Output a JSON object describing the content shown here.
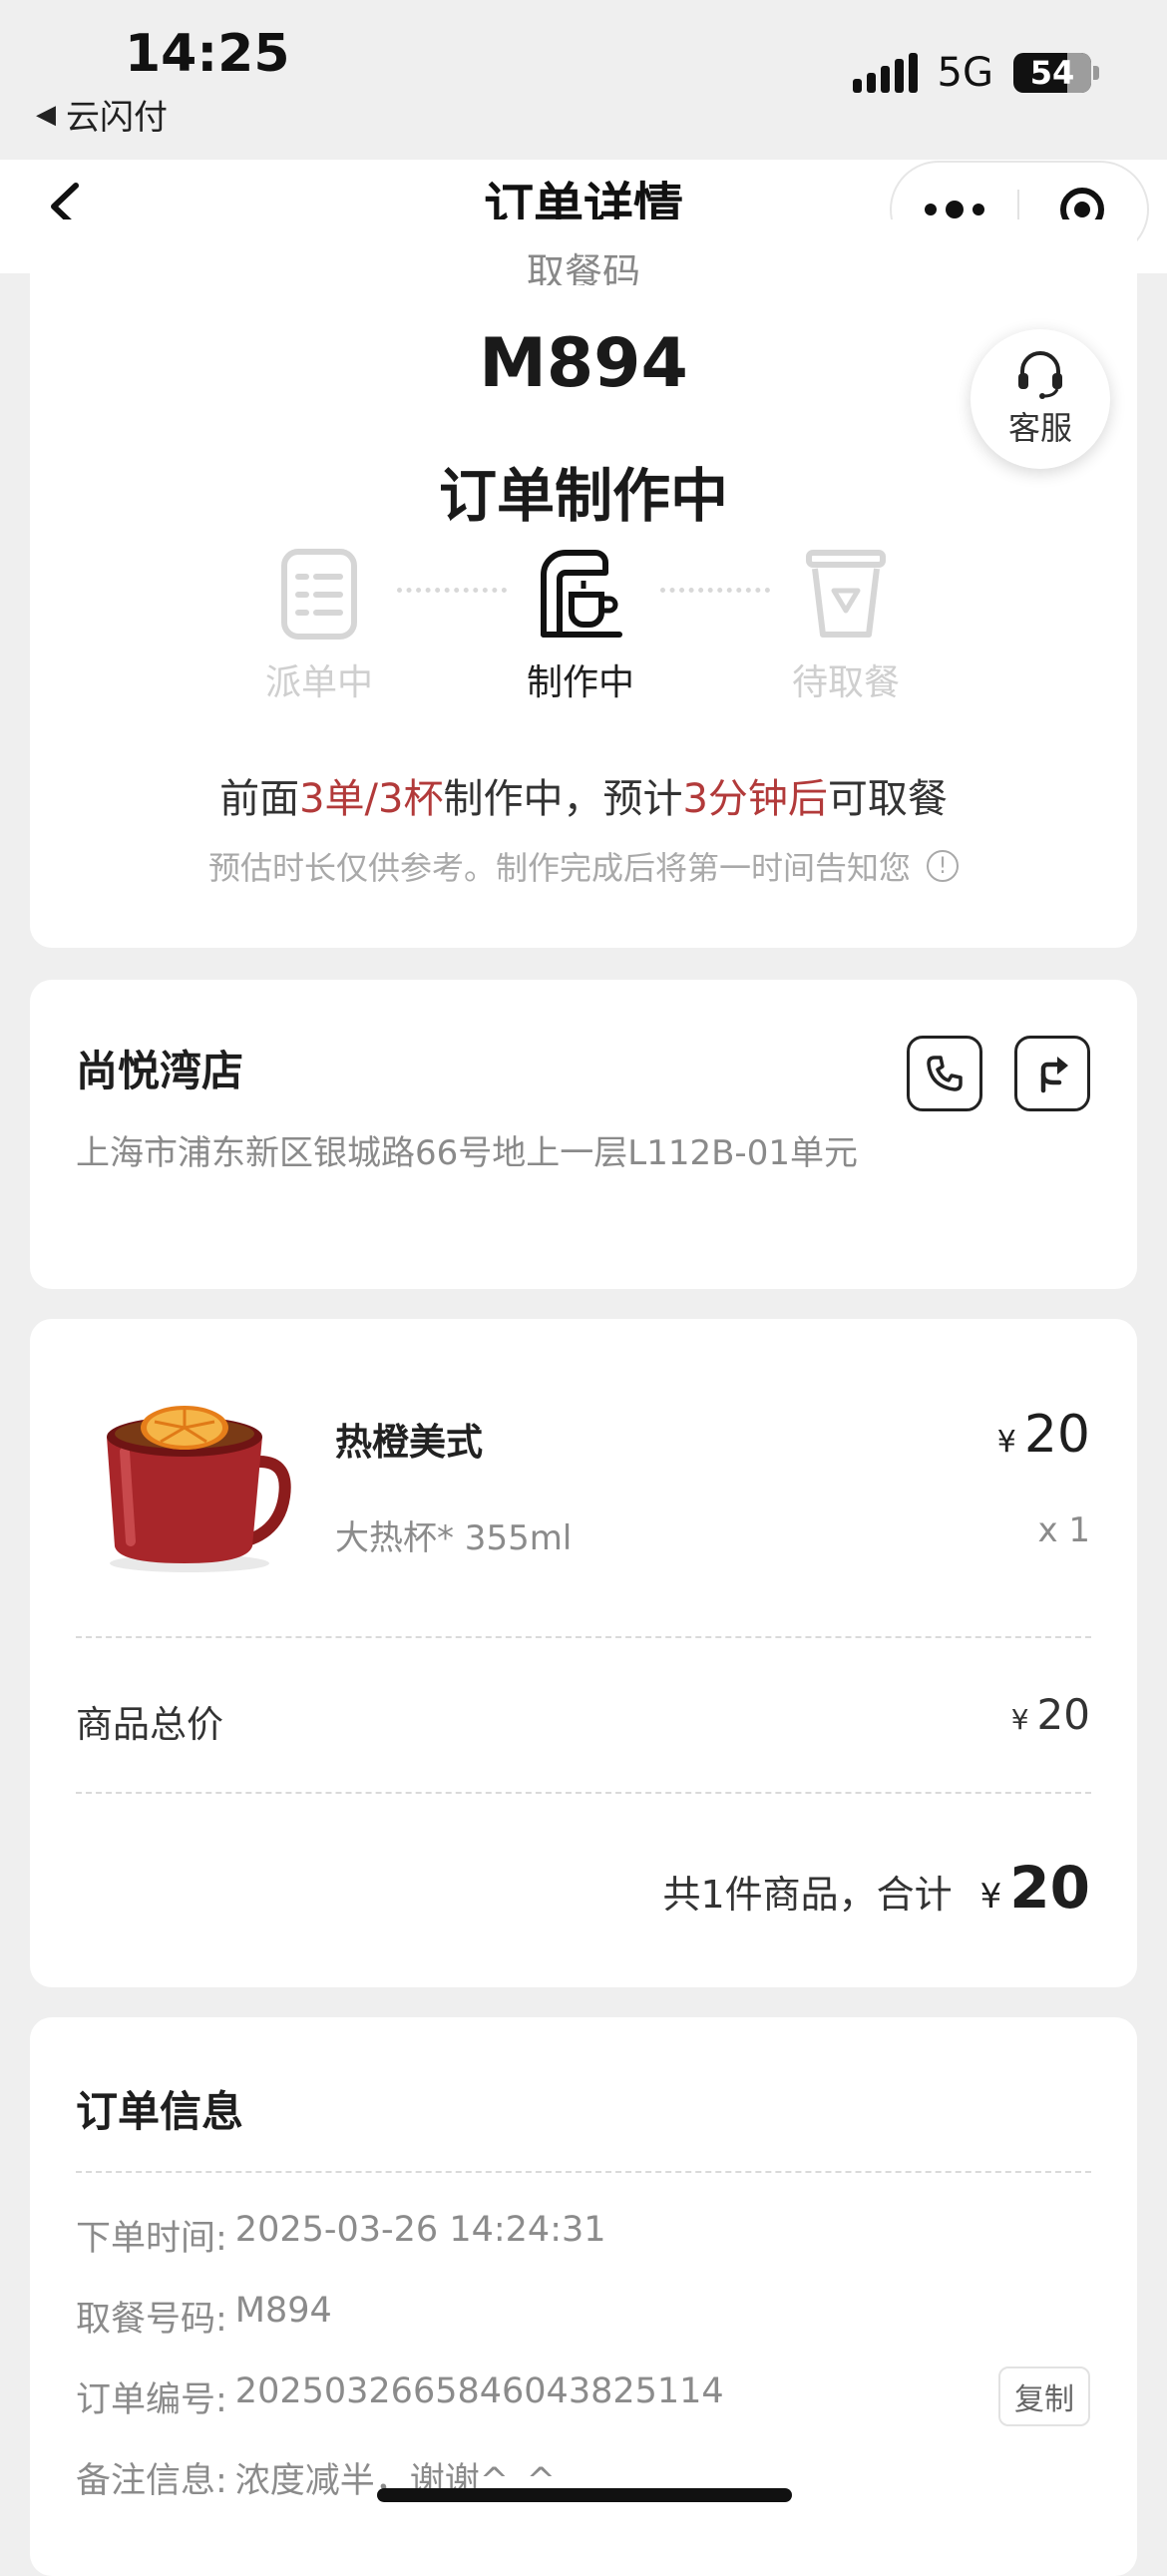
{
  "status_bar": {
    "time": "14:25",
    "back_app": "云闪付",
    "network": "5G",
    "battery": "54"
  },
  "nav": {
    "title": "订单详情"
  },
  "pickup": {
    "label": "取餐码",
    "code": "M894",
    "state": "订单制作中"
  },
  "service": {
    "label": "客服"
  },
  "progress": {
    "steps": [
      {
        "label": "派单中",
        "active": false
      },
      {
        "label": "制作中",
        "active": true
      },
      {
        "label": "待取餐",
        "active": false
      }
    ]
  },
  "wait": {
    "prefix": "前面",
    "queue": "3单/3杯",
    "mid": "制作中，预计",
    "eta": "3分钟后",
    "suffix": "可取餐",
    "hint": "预估时长仅供参考。制作完成后将第一时间告知您"
  },
  "store": {
    "name": "尚悦湾店",
    "address": "上海市浦东新区银城路66号地上一层L112B-01单元"
  },
  "product": {
    "name": "热橙美式",
    "spec": "大热杯* 355ml",
    "currency": "¥",
    "price": "20",
    "qty": "x 1"
  },
  "summary": {
    "subtotal_label": "商品总价",
    "subtotal_currency": "¥",
    "subtotal_value": "20",
    "total_label": "共1件商品，合计",
    "total_currency": "¥",
    "total_value": "20"
  },
  "order_info": {
    "title": "订单信息",
    "rows": [
      {
        "label": "下单时间:",
        "value": "2025-03-26 14:24:31"
      },
      {
        "label": "取餐号码:",
        "value": "M894"
      },
      {
        "label": "订单编号:",
        "value": "2025032665846043825114"
      },
      {
        "label": "备注信息:",
        "value": "浓度减半，谢谢^_^"
      }
    ],
    "copy_label": "复制"
  },
  "colors": {
    "highlight": "#b23a3a",
    "muted": "#a9a9a9",
    "background": "#efefef"
  }
}
